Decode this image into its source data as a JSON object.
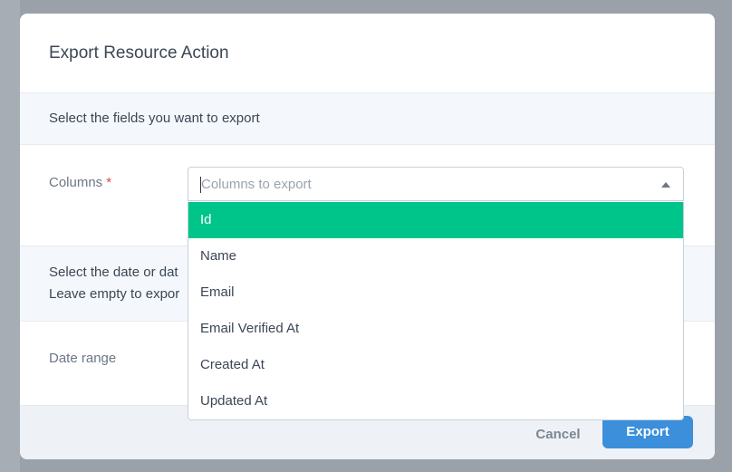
{
  "modal": {
    "title": "Export Resource Action",
    "section1_text": "Select the fields you want to export",
    "columns_label": "Columns",
    "required_mark": "*",
    "section2_line1": "Select the date or dat",
    "section2_line2": "Leave empty to expor",
    "date_range_label": "Date range"
  },
  "select": {
    "placeholder": "Columns to export",
    "options": [
      "Id",
      "Name",
      "Email",
      "Email Verified At",
      "Created At",
      "Updated At"
    ],
    "highlighted": "Id"
  },
  "footer": {
    "cancel_label": "Cancel",
    "export_label": "Export"
  },
  "colors": {
    "accent_green": "#00c58a",
    "primary_blue": "#3b8fdb",
    "required_red": "#e74444"
  }
}
